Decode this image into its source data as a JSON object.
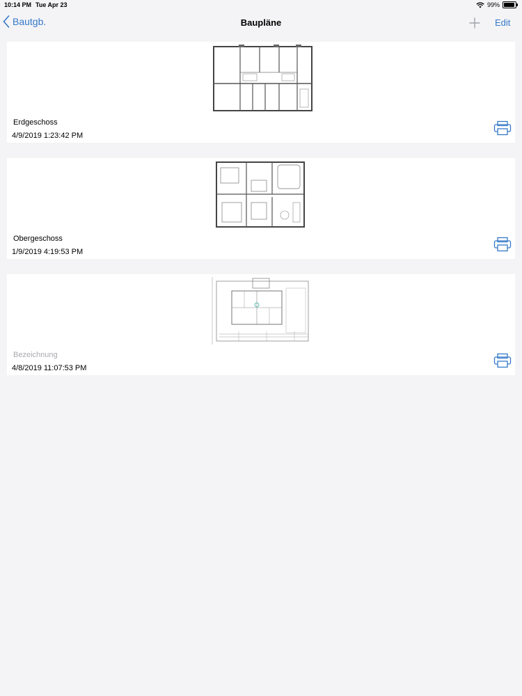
{
  "status": {
    "time": "10:14 PM",
    "date": "Tue Apr 23",
    "battery": "99%"
  },
  "nav": {
    "back_label": "Bautgb.",
    "title": "Baupläne",
    "edit_label": "Edit"
  },
  "plans": [
    {
      "name": "Erdgeschoss",
      "date": "4/9/2019 1:23:42 PM",
      "is_placeholder": false
    },
    {
      "name": "Obergeschoss",
      "date": "1/9/2019 4:19:53 PM",
      "is_placeholder": false
    },
    {
      "name": "Bezeichnung",
      "date": "4/8/2019 11:07:53 PM",
      "is_placeholder": true
    }
  ],
  "colors": {
    "accent": "#3478c8",
    "background": "#f4f4f6",
    "card": "#ffffff",
    "placeholder_text": "#a9a9ae"
  },
  "icons": {
    "back": "chevron-left-icon",
    "add": "plus-icon",
    "print": "printer-icon"
  }
}
